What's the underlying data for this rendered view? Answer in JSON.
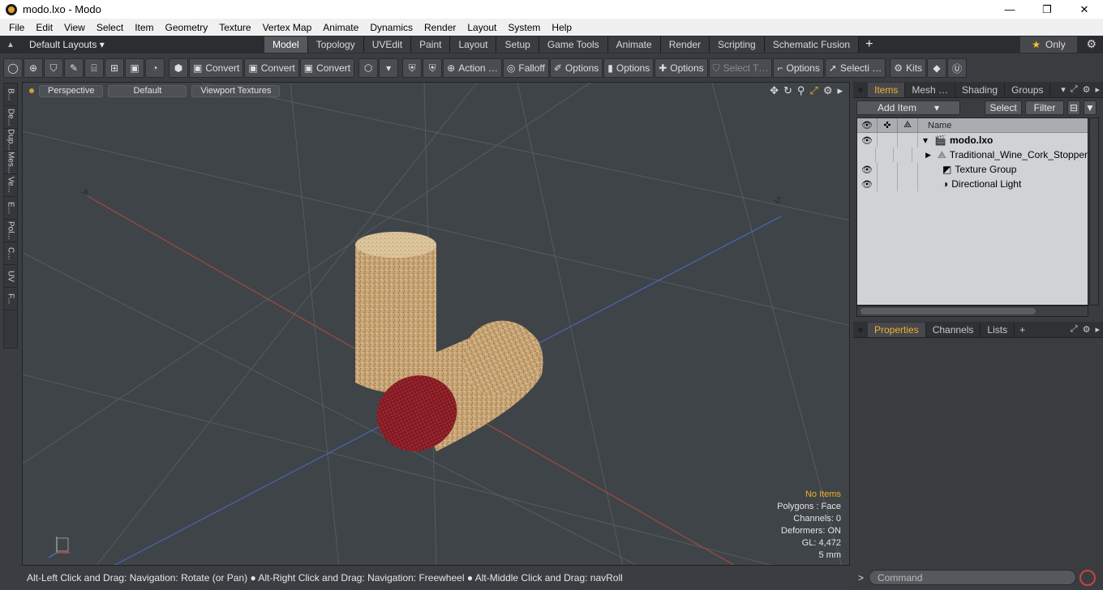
{
  "window": {
    "title": "modo.lxo - Modo",
    "minimize": "—",
    "maximize": "❐",
    "close": "✕"
  },
  "menu": [
    "File",
    "Edit",
    "View",
    "Select",
    "Item",
    "Geometry",
    "Texture",
    "Vertex Map",
    "Animate",
    "Dynamics",
    "Render",
    "Layout",
    "System",
    "Help"
  ],
  "layoutbar": {
    "layout_select": "Default Layouts ▾",
    "tabs": [
      "Model",
      "Topology",
      "UVEdit",
      "Paint",
      "Layout",
      "Setup",
      "Game Tools",
      "Animate",
      "Render",
      "Scripting",
      "Schematic Fusion"
    ],
    "active_tab": "Model",
    "only_label": "Only"
  },
  "toolbar": {
    "convert1": "Convert",
    "convert2": "Convert",
    "convert3": "Convert",
    "action": "Action …",
    "falloff": "Falloff",
    "options1": "Options",
    "options2": "Options",
    "options3": "Options",
    "select_t": "Select T…",
    "options4": "Options",
    "selecti": "Selecti …",
    "kits": "Kits"
  },
  "lefttabs": [
    "B...",
    "De...",
    "Dup...",
    "Mes...",
    "Ve...",
    "E...",
    "Pol...",
    "C...",
    "UV",
    "F..."
  ],
  "viewport": {
    "view_mode": "Perspective",
    "shading": "Default",
    "textures": "Viewport Textures",
    "info": {
      "no_items": "No Items",
      "polygons": "Polygons : Face",
      "channels": "Channels: 0",
      "deformers": "Deformers: ON",
      "gl": "GL: 4,472",
      "unit": "5 mm"
    },
    "axis_neg_x": "-X",
    "axis_neg_z": "-Z"
  },
  "statusbar": "Alt-Left Click and Drag: Navigation: Rotate (or Pan) ● Alt-Right Click and Drag: Navigation: Freewheel ● Alt-Middle Click and Drag: navRoll",
  "items_panel": {
    "tabs": [
      "Items",
      "Mesh …",
      "Shading",
      "Groups"
    ],
    "active_tab": "Items",
    "add_item": "Add Item",
    "select": "Select",
    "filter": "Filter",
    "column_name": "Name",
    "rows": [
      {
        "label": "modo.lxo",
        "visible": true
      },
      {
        "label": "Traditional_Wine_Cork_Stopper",
        "visible": false
      },
      {
        "label": "Texture Group",
        "visible": true
      },
      {
        "label": "Directional Light",
        "visible": true
      }
    ]
  },
  "props_panel": {
    "tabs": [
      "Properties",
      "Channels",
      "Lists"
    ],
    "active_tab": "Properties"
  },
  "command": {
    "placeholder": "Command",
    "prompt": ">"
  }
}
